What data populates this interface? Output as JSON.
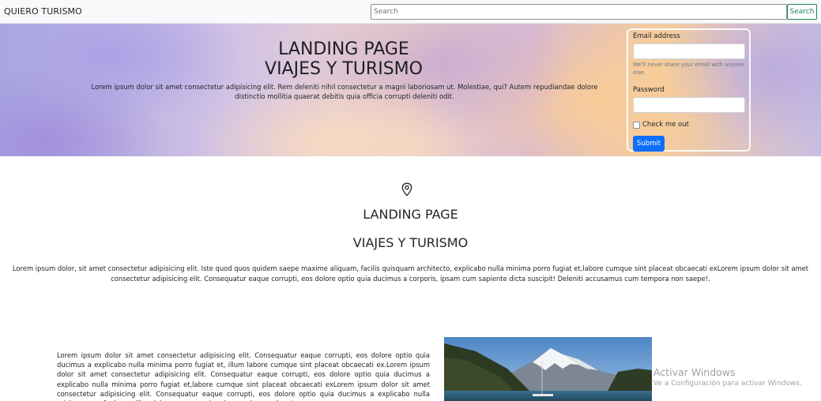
{
  "navbar": {
    "brand": "QUIERO TURISMO",
    "search_placeholder": "Search",
    "search_button": "Search"
  },
  "hero": {
    "title_line1": "LANDING PAGE",
    "title_line2": "VIAJES Y TURISMO",
    "text": "Lorem ipsum dolor sit amet consectetur adipisicing elit. Rem deleniti nihil consectetur a magni laboriosam ut. Molestiae, qui? Autem repudiandae dolore distinctio mollitia quaerat debitis quia officia corrupti deleniti odit."
  },
  "login_form": {
    "email_label": "Email address",
    "email_help": "We'll never share your email with anyone else.",
    "password_label": "Password",
    "checkbox_label": "Check me out",
    "submit_label": "Submit"
  },
  "main": {
    "icon": "map-pin-icon",
    "title_line1": "LANDING PAGE",
    "title_line2": "VIAJES Y TURISMO",
    "text": "Lorem ipsum dolor, sit amet consectetur adipisicing elit. Iste quod quos quidem saepe maxime aliquam, facilis quisquam architecto, explicabo nulla minima porro fugiat et,labore cumque sint placeat obcaecati exLorem ipsum dolor sit amet consectetur adipisicing elit. Consequatur eaque corrupti, eos dolore optio quia ducimus a corporis, ipsam cum sapiente dicta suscipit! Deleniti accusamus cum tempora non saepe!."
  },
  "bottom": {
    "text": "Lorem ipsum dolor sit amet consectetur adipisicing elit. Consequatur eaque corrupti, eos dolore optio quia ducimus a explicabo nulla minima porro fugiat et, illum labore cumque sint placeat obcaecati ex.Lorem ipsum dolor sit amet consectetur adipisicing elit. Consequatur eaque corrupti, eos dolore optio quia ducimus a explicabo nulla minima porro fugiat et,labore cumque sint placeat obcaecati exLorem ipsum dolor sit amet consectetur adipisicing elit. Consequatur eaque corrupti, eos dolore optio quia ducimus a explicabo nulla minima porro fugiat et, illum labore cumque sint placeat obcaecati ex.Lorem"
  },
  "watermark": {
    "title": "Activar Windows",
    "subtitle": "Ve a Configuración para activar Windows."
  }
}
